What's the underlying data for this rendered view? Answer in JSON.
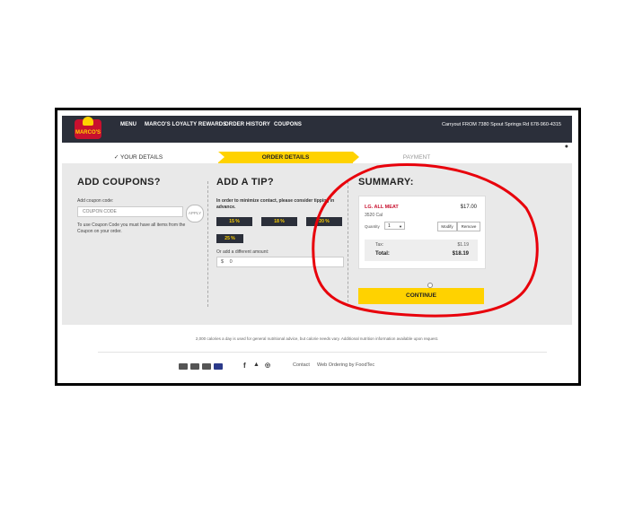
{
  "nav": {
    "items": [
      "MENU",
      "MARCO'S LOYALTY REWARDS",
      "ORDER HISTORY",
      "COUPONS"
    ],
    "store": "Carryout FROM 7380 Spout Springs Rd   678-960-4315",
    "logo_text": "MARCO'S"
  },
  "steps": {
    "done": "✓ YOUR DETAILS",
    "active": "ORDER DETAILS",
    "next": "PAYMENT"
  },
  "coupons": {
    "title": "ADD COUPONS?",
    "label": "Add coupon code:",
    "placeholder": "COUPON CODE",
    "apply": "APPLY",
    "note": "To use Coupon Code you must have all items from the Coupon on your order."
  },
  "tip": {
    "title": "ADD A TIP?",
    "note": "In order to minimize contact, please consider tipping in advance.",
    "options": [
      "15 %",
      "18 %",
      "20 %",
      "25 %"
    ],
    "other_label": "Or add a different amount:",
    "currency": "$",
    "amount": "0"
  },
  "summary": {
    "title": "SUMMARY:",
    "item_name": "LG. ALL MEAT",
    "item_price": "$17.00",
    "calories": "3520 Cal",
    "quantity_label": "Quantity",
    "quantity": "1",
    "modify": "Modify",
    "remove": "Remove",
    "tax_label": "Tax:",
    "tax": "$1.19",
    "total_label": "Total:",
    "total": "$18.19",
    "continue": "CONTINUE"
  },
  "disclaimer": "2,000 calories a day is used for general nutritional advice, but calorie needs vary. Additional nutrition information available upon request.",
  "footer": {
    "contact": "Contact",
    "web_ordering": "Web Ordering by FoodTec"
  },
  "colors": {
    "accent": "#ffd200",
    "nav_bg": "#2b2f3a",
    "brand_red": "#c8102e",
    "annotation_red": "#e8000b"
  }
}
